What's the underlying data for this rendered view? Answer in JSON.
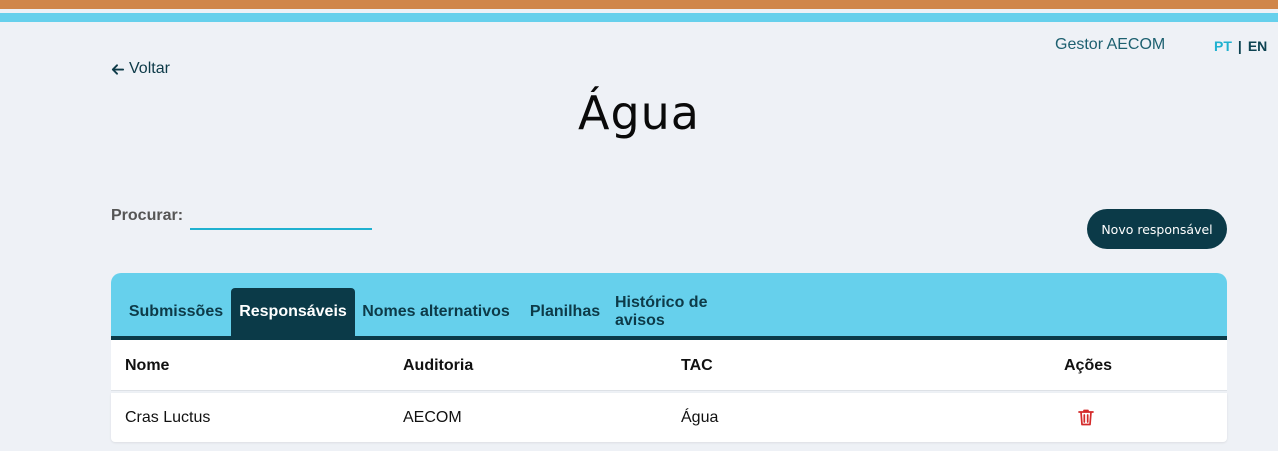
{
  "header": {
    "user_name": "Gestor AECOM",
    "lang_pt": "PT",
    "lang_sep": "|",
    "lang_en": "EN",
    "back_label": "Voltar"
  },
  "page": {
    "title": "Água"
  },
  "search": {
    "label": "Procurar:",
    "value": "",
    "placeholder": ""
  },
  "actions": {
    "new_button": "Novo responsável"
  },
  "tabs": [
    {
      "label": "Submissões",
      "active": false
    },
    {
      "label": "Responsáveis",
      "active": true
    },
    {
      "label": "Nomes alternativos",
      "active": false
    },
    {
      "label": "Planilhas",
      "active": false
    },
    {
      "label": "Histórico de avisos",
      "active": false
    }
  ],
  "table": {
    "columns": [
      "Nome",
      "Auditoria",
      "TAC",
      "Ações"
    ],
    "rows": [
      {
        "nome": "Cras Luctus",
        "auditoria": "AECOM",
        "tac": "Água",
        "action_icon": "trash-icon"
      }
    ]
  },
  "colors": {
    "top_bar_orange": "#d0864a",
    "top_bar_cyan": "#66d0ec",
    "dark_teal": "#0b3a48",
    "accent_cyan": "#1fb1d0",
    "danger_red": "#d42a2a"
  }
}
